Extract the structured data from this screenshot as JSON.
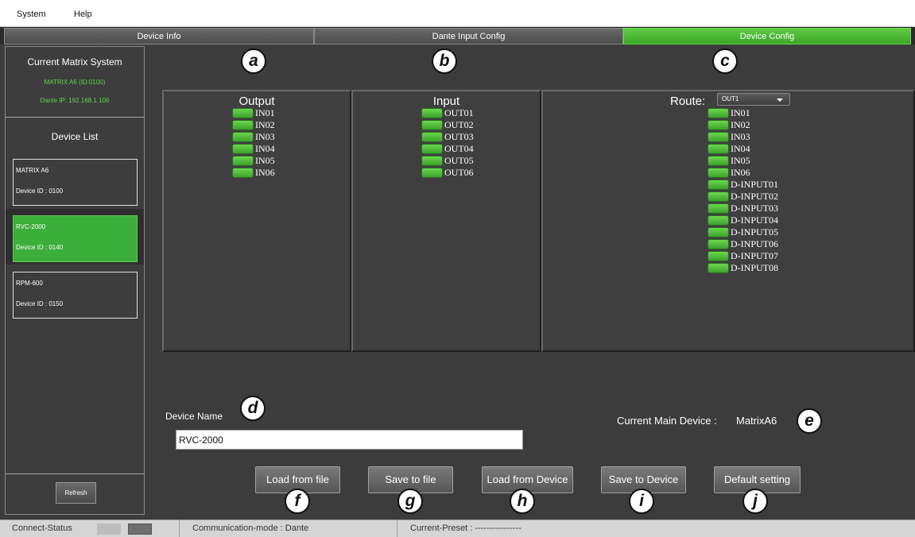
{
  "menu": {
    "items": [
      "System",
      "Help"
    ]
  },
  "tabs": [
    {
      "label": "Device Info",
      "active": false
    },
    {
      "label": "Dante Input Config",
      "active": false
    },
    {
      "label": "Device Config",
      "active": true
    }
  ],
  "sidebar": {
    "matrix_title": "Current Matrix System",
    "matrix_name": "MATRIX A6 (ID:0100)",
    "dante_ip": "Dante IP: 192.168.1.106",
    "device_list_title": "Device List",
    "devices": [
      {
        "name": "MATRIX A6",
        "id": "Device ID : 0100",
        "selected": false
      },
      {
        "name": "RVC-2000",
        "id": "Device ID : 0140",
        "selected": true
      },
      {
        "name": "RPM-600",
        "id": "Device ID : 0150",
        "selected": false
      }
    ],
    "refresh_label": "Refresh"
  },
  "output_panel": {
    "title": "Output",
    "channels": [
      "IN01",
      "IN02",
      "IN03",
      "IN04",
      "IN05",
      "IN06"
    ]
  },
  "input_panel": {
    "title": "Input",
    "channels": [
      "OUT01",
      "OUT02",
      "OUT03",
      "OUT04",
      "OUT05",
      "OUT06"
    ]
  },
  "route_panel": {
    "title": "Route:",
    "selected": "OUT1",
    "channels": [
      "IN01",
      "IN02",
      "IN03",
      "IN04",
      "IN05",
      "IN06",
      "D-INPUT01",
      "D-INPUT02",
      "D-INPUT03",
      "D-INPUT04",
      "D-INPUT05",
      "D-INPUT06",
      "D-INPUT07",
      "D-INPUT08"
    ]
  },
  "device_name": {
    "label": "Device Name",
    "value": "RVC-2000"
  },
  "main_device": {
    "label": "Current Main Device :",
    "value": "MatrixA6"
  },
  "buttons": {
    "load_from_file": "Load from file",
    "save_to_file": "Save to file",
    "load_from_device": "Load from Device",
    "save_to_device": "Save to Device",
    "default_setting": "Default setting"
  },
  "callouts": {
    "a": "a",
    "b": "b",
    "c": "c",
    "d": "d",
    "e": "e",
    "f": "f",
    "g": "g",
    "h": "h",
    "i": "i",
    "j": "j"
  },
  "status": {
    "connect": "Connect-Status",
    "mode": "Communication-mode : Dante",
    "preset": "Current-Preset : ----------------"
  },
  "colors": {
    "accent_green": "#3cae3a",
    "led_green": "#5ccb45",
    "panel_bg": "#3c3c3c"
  }
}
